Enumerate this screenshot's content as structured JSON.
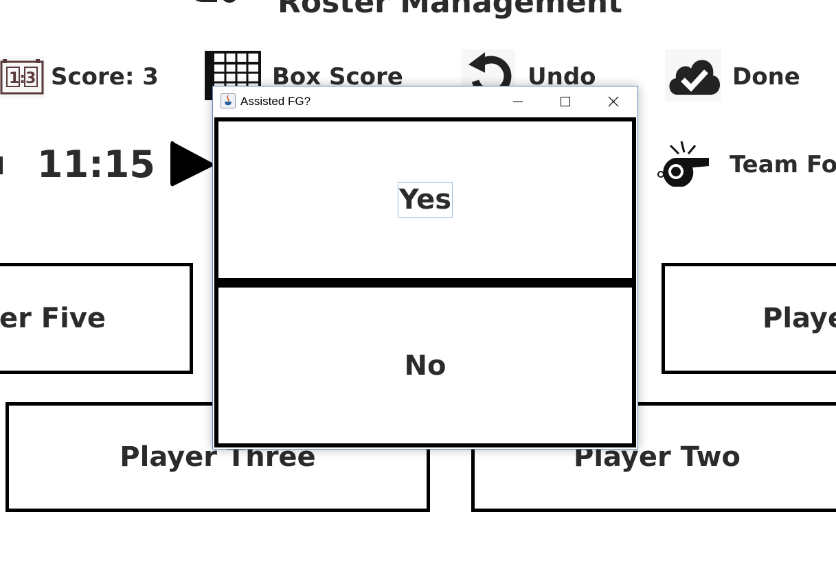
{
  "header": {
    "title": "Roster Management",
    "title_icon": "roster-person-icon"
  },
  "toolbar": {
    "score_label": "Score: 3",
    "score_icon_digits": "1:3",
    "box_score_label": "Box Score",
    "undo_label": "Undo",
    "done_label": "Done"
  },
  "clock": {
    "time": "11:15",
    "team_fouls_label": "Team Fo"
  },
  "players": {
    "five": "er Five",
    "one_partial": "Playe",
    "three": "Player Three",
    "two": "Player Two"
  },
  "dialog": {
    "title": "Assisted FG?",
    "yes_label": "Yes",
    "no_label": "No"
  },
  "colors": {
    "dialog_border": "#5a86b8",
    "text": "#2b2b2b"
  }
}
